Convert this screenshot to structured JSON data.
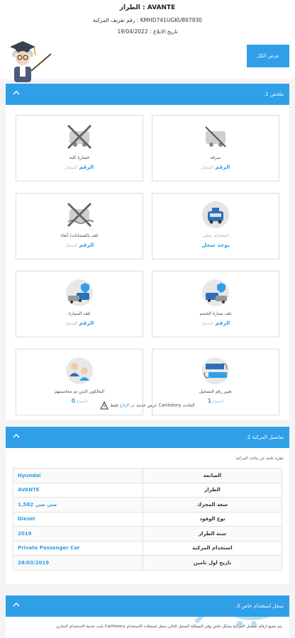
{
  "header": {
    "model_line": "AVANTE : الطراز",
    "vin_line": "KMHD741UGKU897930 : رقم تعريف المركبة",
    "date_line": "تاريخ الابلاغ : 19/04/2022",
    "view_all_label": "عرض الكل"
  },
  "section1": {
    "title": "ملخص 1.",
    "cards": [
      {
        "label": "سرقة",
        "value": "الرقم",
        "value_suffix": "السجل"
      },
      {
        "label": "خسارة كلية",
        "value": "الرقم",
        "value_suffix": "السجل"
      },
      {
        "label": "استخدام عملي",
        "value": "يوجد سجل",
        "value_suffix": ""
      },
      {
        "label": "تلف بالفيضانات/ أنقاء",
        "value": "الرقم",
        "value_suffix": "السجل"
      },
      {
        "label": "تلف سيارة الخصم",
        "value": "الرقم",
        "value_suffix": "السجل"
      },
      {
        "label": "تلف السيارة",
        "value": "الرقم",
        "value_suffix": "السجل"
      },
      {
        "label": "تغيير رقم التسجيل",
        "value": "1",
        "value_suffix": "السجل"
      },
      {
        "label": "المالكون الذين تم محاسبتهم",
        "value": "0",
        "value_suffix": "السجل"
      }
    ],
    "note_prefix": "فقط",
    "note_highlight": "تم الإبلاغ",
    "note_suffix": "الحادث CarHistory عرض خدمة"
  },
  "section2": {
    "title": "تفاصيل المركبة 2.",
    "subtitle": "نظرة عامة عن بيانات المركبة",
    "rows": [
      {
        "key": "الصانعة",
        "value": "Hyundai"
      },
      {
        "key": "الطراز",
        "value": "AVANTE"
      },
      {
        "key": "سعة المحرك",
        "value": "1,582 سي سي"
      },
      {
        "key": "نوع الوقود",
        "value": "Diesel"
      },
      {
        "key": "سنة الطراز",
        "value": "2019"
      },
      {
        "key": "استخدام المركبة",
        "value": "Private  Passenger Car"
      },
      {
        "key": "تاريخ اول تامين",
        "value": "28/03/2019"
      }
    ]
  },
  "section3": {
    "title": "سجل استخدام خاص 3.",
    "paragraph": "يتم جميع ارقام تسجيل المركبة بشكل خاص وفي المملكة السجل التالي سجل لسجلات الاستخدام CarHistory تثبت خدمة الاستخدام التجاري"
  },
  "colors": {
    "accent": "#2f9fe8",
    "background": "#f4f4f6"
  }
}
